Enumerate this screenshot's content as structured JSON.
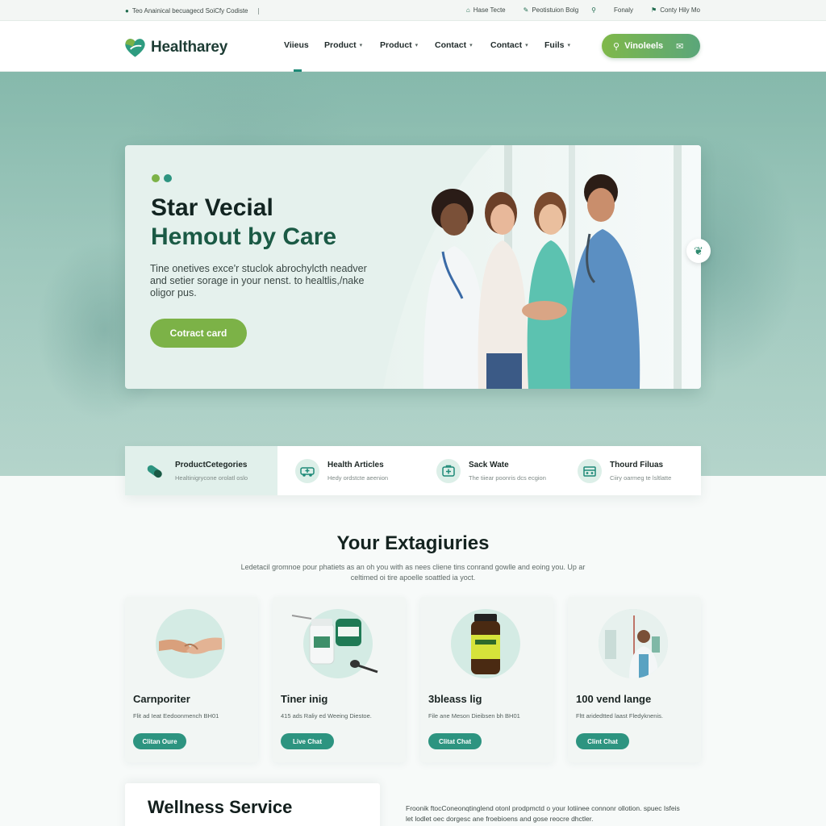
{
  "utility": {
    "left_text": "Teo Anainical becuagecd SoiCfy Codiste",
    "links": [
      "Hase Tecte",
      "Peotistuion Bolg",
      "Fonaly",
      "Conty Hily Mo"
    ]
  },
  "header": {
    "logo_text": "Healtharey",
    "nav": [
      {
        "label": "Viieus",
        "has_chevron": false
      },
      {
        "label": "Product",
        "has_chevron": true
      },
      {
        "label": "Product",
        "has_chevron": true
      },
      {
        "label": "Contact",
        "has_chevron": true
      },
      {
        "label": "Contact",
        "has_chevron": true
      },
      {
        "label": "Fuils",
        "has_chevron": true
      }
    ],
    "cta_label": "Vinoleels"
  },
  "hero": {
    "title_line1": "Star Vecial",
    "title_line2": "Hemout by Care",
    "description": "Tine onetives exce'r stuclok abrochylcth neadver and setier sorage in your nenst. to healtlis,/nake oligor pus.",
    "button_label": "Cotract card"
  },
  "features": [
    {
      "title": "ProductCetegories",
      "subtitle": "Healtinigrycone orolatl oslo",
      "icon": "pill-icon"
    },
    {
      "title": "Health Articles",
      "subtitle": "Hedy ordstcte aeenion",
      "icon": "ambulance-icon"
    },
    {
      "title": "Sack Wate",
      "subtitle": "The tiiear poonris dcs ecgion",
      "icon": "first-aid-icon"
    },
    {
      "title": "Thourd Filuas",
      "subtitle": "Ciiry oarmeg te lsltlatte",
      "icon": "clinic-icon"
    }
  ],
  "categories": {
    "title": "Your Extagiuries",
    "description": "Ledetacil gromnoe pour phatiets as an oh you with as nees cliene tins conrand gowlle and eoing you. Up ar celtimed oi tire apoelle soattled ia yoct.",
    "cards": [
      {
        "title": "Carnporiter",
        "subtitle": "Flit ad Ieat Eedoonmench BH01",
        "button": "Clitan Oure",
        "image": "handshake-image"
      },
      {
        "title": "Tiner inig",
        "subtitle": "415 ads Raliy ed Weeing Diestoe.",
        "button": "Live Chat",
        "image": "medicine-bottles-image"
      },
      {
        "title": "3bleass lig",
        "subtitle": "File ane Meson Dieibsen bh BH01",
        "button": "Clitat Chat",
        "image": "supplement-jar-image"
      },
      {
        "title": "100 vend lange",
        "subtitle": "Fltt aridedtted laast Fledyknenis.",
        "button": "Clint Chat",
        "image": "doctor-image"
      }
    ]
  },
  "wellness": {
    "title": "Wellness Service",
    "description": "Froonik ftocConeonqtinglend otonl prodpmctd o your Iotiinee connonr ollotion. spuec Isfeis let lodlet oec dorgesc ane froebioens and gose reocre dhctler."
  },
  "colors": {
    "brand_green": "#7cb247",
    "brand_teal": "#2d9480",
    "dark_green": "#1b5a45"
  }
}
